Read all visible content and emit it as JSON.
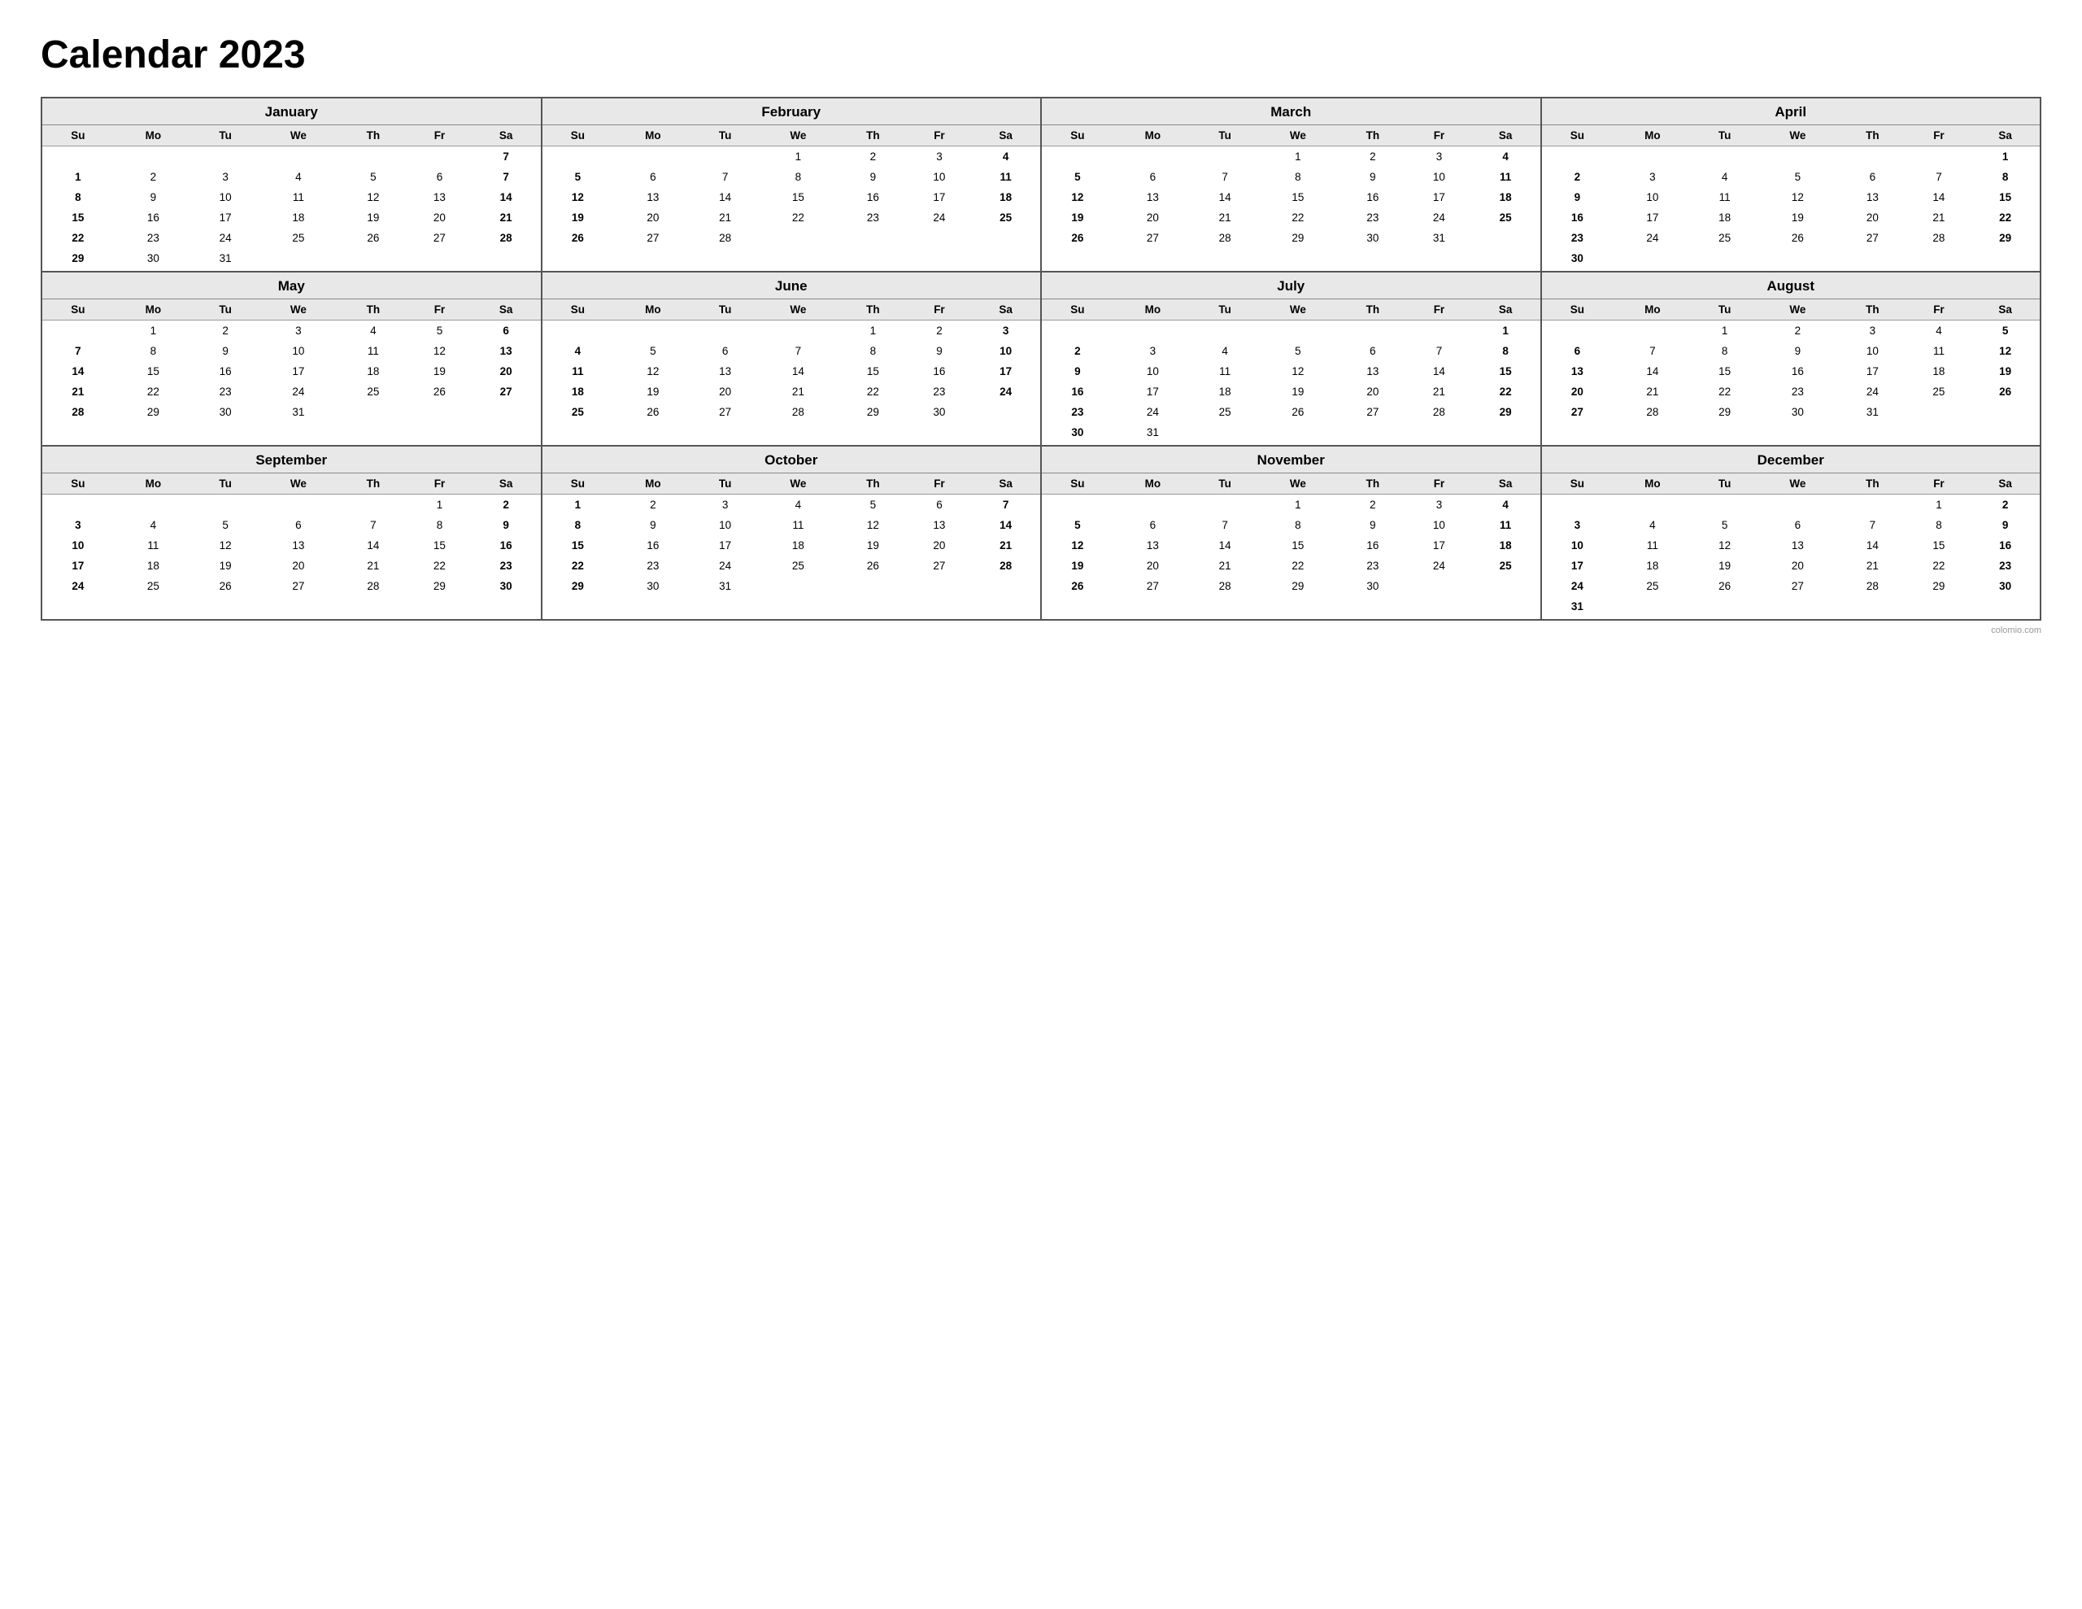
{
  "title": "Calendar 2023",
  "watermark": "colomio.com",
  "months": [
    {
      "name": "January",
      "days": [
        [
          "",
          "",
          "",
          "",
          "",
          "",
          "7"
        ],
        [
          "1",
          "2",
          "3",
          "4",
          "5",
          "6",
          "7"
        ],
        [
          "8",
          "9",
          "10",
          "11",
          "12",
          "13",
          "14"
        ],
        [
          "15",
          "16",
          "17",
          "18",
          "19",
          "20",
          "21"
        ],
        [
          "22",
          "23",
          "24",
          "25",
          "26",
          "27",
          "28"
        ],
        [
          "29",
          "30",
          "31",
          "",
          "",
          "",
          ""
        ]
      ],
      "startDay": 0
    },
    {
      "name": "February",
      "days": [
        [
          "",
          "",
          "",
          "1",
          "2",
          "3",
          "4"
        ],
        [
          "5",
          "6",
          "7",
          "8",
          "9",
          "10",
          "11"
        ],
        [
          "12",
          "13",
          "14",
          "15",
          "16",
          "17",
          "18"
        ],
        [
          "19",
          "20",
          "21",
          "22",
          "23",
          "24",
          "25"
        ],
        [
          "26",
          "27",
          "28",
          "",
          "",
          "",
          ""
        ]
      ],
      "startDay": 3
    },
    {
      "name": "March",
      "days": [
        [
          "",
          "",
          "",
          "1",
          "2",
          "3",
          "4"
        ],
        [
          "5",
          "6",
          "7",
          "8",
          "9",
          "10",
          "11"
        ],
        [
          "12",
          "13",
          "14",
          "15",
          "16",
          "17",
          "18"
        ],
        [
          "19",
          "20",
          "21",
          "22",
          "23",
          "24",
          "25"
        ],
        [
          "26",
          "27",
          "28",
          "29",
          "30",
          "31",
          ""
        ]
      ],
      "startDay": 3
    },
    {
      "name": "April",
      "days": [
        [
          "",
          "",
          "",
          "",
          "",
          "",
          "1"
        ],
        [
          "2",
          "3",
          "4",
          "5",
          "6",
          "7",
          "8"
        ],
        [
          "9",
          "10",
          "11",
          "12",
          "13",
          "14",
          "15"
        ],
        [
          "16",
          "17",
          "18",
          "19",
          "20",
          "21",
          "22"
        ],
        [
          "23",
          "24",
          "25",
          "26",
          "27",
          "28",
          "29"
        ],
        [
          "30",
          "",
          "",
          "",
          "",
          "",
          ""
        ]
      ],
      "startDay": 6
    },
    {
      "name": "May",
      "days": [
        [
          "",
          "1",
          "2",
          "3",
          "4",
          "5",
          "6"
        ],
        [
          "7",
          "8",
          "9",
          "10",
          "11",
          "12",
          "13"
        ],
        [
          "14",
          "15",
          "16",
          "17",
          "18",
          "19",
          "20"
        ],
        [
          "21",
          "22",
          "23",
          "24",
          "25",
          "26",
          "27"
        ],
        [
          "28",
          "29",
          "30",
          "31",
          "",
          "",
          ""
        ]
      ],
      "startDay": 1
    },
    {
      "name": "June",
      "days": [
        [
          "",
          "",
          "",
          "",
          "1",
          "2",
          "3"
        ],
        [
          "4",
          "5",
          "6",
          "7",
          "8",
          "9",
          "10"
        ],
        [
          "11",
          "12",
          "13",
          "14",
          "15",
          "16",
          "17"
        ],
        [
          "18",
          "19",
          "20",
          "21",
          "22",
          "23",
          "24"
        ],
        [
          "25",
          "26",
          "27",
          "28",
          "29",
          "30",
          ""
        ]
      ],
      "startDay": 4
    },
    {
      "name": "July",
      "days": [
        [
          "",
          "",
          "",
          "",
          "",
          "",
          "1"
        ],
        [
          "2",
          "3",
          "4",
          "5",
          "6",
          "7",
          "8"
        ],
        [
          "9",
          "10",
          "11",
          "12",
          "13",
          "14",
          "15"
        ],
        [
          "16",
          "17",
          "18",
          "19",
          "20",
          "21",
          "22"
        ],
        [
          "23",
          "24",
          "25",
          "26",
          "27",
          "28",
          "29"
        ],
        [
          "30",
          "31",
          "",
          "",
          "",
          "",
          ""
        ]
      ],
      "startDay": 6
    },
    {
      "name": "August",
      "days": [
        [
          "",
          "",
          "1",
          "2",
          "3",
          "4",
          "5"
        ],
        [
          "6",
          "7",
          "8",
          "9",
          "10",
          "11",
          "12"
        ],
        [
          "13",
          "14",
          "15",
          "16",
          "17",
          "18",
          "19"
        ],
        [
          "20",
          "21",
          "22",
          "23",
          "24",
          "25",
          "26"
        ],
        [
          "27",
          "28",
          "29",
          "30",
          "31",
          "",
          ""
        ]
      ],
      "startDay": 2
    },
    {
      "name": "September",
      "days": [
        [
          "",
          "",
          "",
          "",
          "",
          "1",
          "2"
        ],
        [
          "3",
          "4",
          "5",
          "6",
          "7",
          "8",
          "9"
        ],
        [
          "10",
          "11",
          "12",
          "13",
          "14",
          "15",
          "16"
        ],
        [
          "17",
          "18",
          "19",
          "20",
          "21",
          "22",
          "23"
        ],
        [
          "24",
          "25",
          "26",
          "27",
          "28",
          "29",
          "30"
        ]
      ],
      "startDay": 5
    },
    {
      "name": "October",
      "days": [
        [
          "1",
          "2",
          "3",
          "4",
          "5",
          "6",
          "7"
        ],
        [
          "8",
          "9",
          "10",
          "11",
          "12",
          "13",
          "14"
        ],
        [
          "15",
          "16",
          "17",
          "18",
          "19",
          "20",
          "21"
        ],
        [
          "22",
          "23",
          "24",
          "25",
          "26",
          "27",
          "28"
        ],
        [
          "29",
          "30",
          "31",
          "",
          "",
          "",
          ""
        ]
      ],
      "startDay": 0
    },
    {
      "name": "November",
      "days": [
        [
          "",
          "",
          "",
          "1",
          "2",
          "3",
          "4"
        ],
        [
          "5",
          "6",
          "7",
          "8",
          "9",
          "10",
          "11"
        ],
        [
          "12",
          "13",
          "14",
          "15",
          "16",
          "17",
          "18"
        ],
        [
          "19",
          "20",
          "21",
          "22",
          "23",
          "24",
          "25"
        ],
        [
          "26",
          "27",
          "28",
          "29",
          "30",
          "",
          ""
        ]
      ],
      "startDay": 3
    },
    {
      "name": "December",
      "days": [
        [
          "",
          "",
          "",
          "",
          "",
          "1",
          "2"
        ],
        [
          "3",
          "4",
          "5",
          "6",
          "7",
          "8",
          "9"
        ],
        [
          "10",
          "11",
          "12",
          "13",
          "14",
          "15",
          "16"
        ],
        [
          "17",
          "18",
          "19",
          "20",
          "21",
          "22",
          "23"
        ],
        [
          "24",
          "25",
          "26",
          "27",
          "28",
          "29",
          "30"
        ],
        [
          "31",
          "",
          "",
          "",
          "",
          "",
          ""
        ]
      ],
      "startDay": 5
    }
  ],
  "dayHeaders": [
    "Su",
    "Mo",
    "Tu",
    "We",
    "Th",
    "Fr",
    "Sa"
  ]
}
